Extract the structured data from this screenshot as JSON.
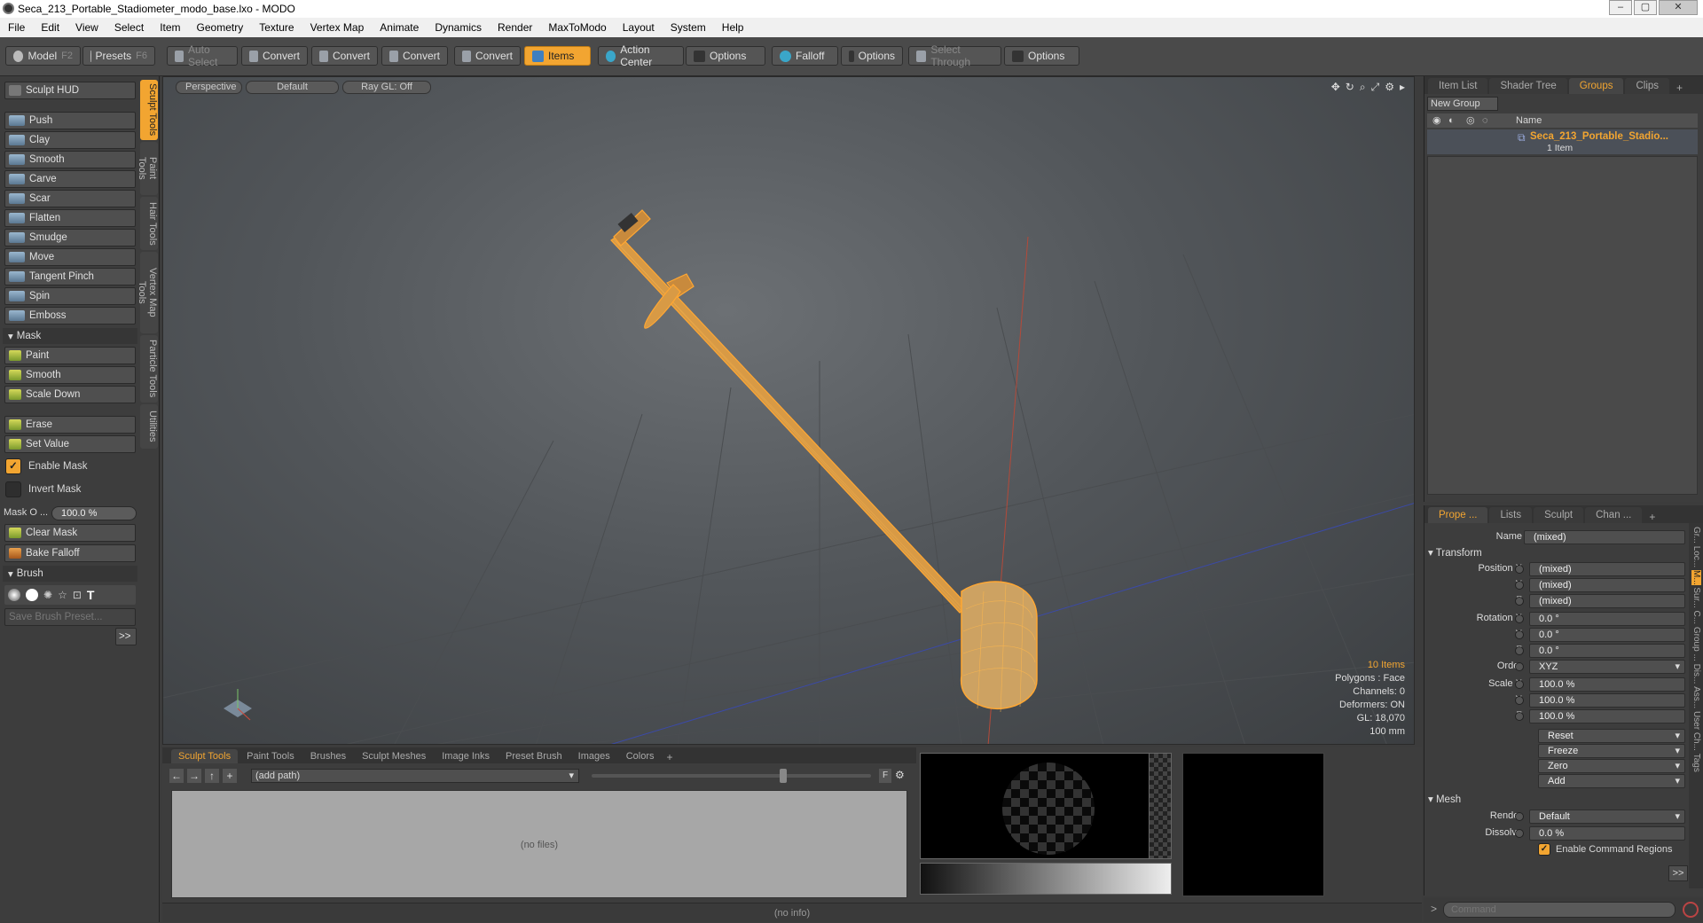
{
  "window": {
    "title": "Seca_213_Portable_Stadiometer_modo_base.lxo - MODO"
  },
  "menu": [
    "File",
    "Edit",
    "View",
    "Select",
    "Item",
    "Geometry",
    "Texture",
    "Vertex Map",
    "Animate",
    "Dynamics",
    "Render",
    "MaxToModo",
    "Layout",
    "System",
    "Help"
  ],
  "toolbar": {
    "model": "Model",
    "model_key": "F2",
    "presets": "Presets",
    "presets_key": "F6",
    "auto_select": "Auto Select",
    "convert1": "Convert",
    "convert2": "Convert",
    "convert3": "Convert",
    "convert4": "Convert",
    "items": "Items",
    "action_center": "Action Center",
    "options1": "Options",
    "falloff": "Falloff",
    "options2": "Options",
    "select_through": "Select Through",
    "options3": "Options"
  },
  "left": {
    "sculpt_hud": "Sculpt HUD",
    "side_tabs": [
      "Sculpt Tools",
      "Paint Tools",
      "Hair Tools",
      "Vertex Map Tools",
      "Particle Tools",
      "Utilities"
    ],
    "tools": [
      "Push",
      "Clay",
      "Smooth",
      "Carve",
      "Scar",
      "Flatten",
      "Smudge",
      "Move",
      "Tangent Pinch",
      "Spin",
      "Emboss"
    ],
    "mask_header": "Mask",
    "mask_tools": [
      "Paint",
      "Smooth",
      "Scale Down"
    ],
    "erase": "Erase",
    "set_value": "Set Value",
    "enable_mask": "Enable Mask",
    "invert_mask": "Invert Mask",
    "mask_opacity_label": "Mask O ...",
    "mask_opacity_value": "100.0 %",
    "clear_mask": "Clear Mask",
    "bake_falloff": "Bake Falloff",
    "brush_header": "Brush",
    "save_brush_preset": "Save Brush Preset...",
    "more": ">>"
  },
  "viewport": {
    "tabs": [
      "Perspective",
      "Default",
      "Ray GL: Off"
    ],
    "stats": {
      "items": "10 Items",
      "polygons": "Polygons : Face",
      "channels": "Channels: 0",
      "deformers": "Deformers: ON",
      "gl": "GL: 18,070",
      "scale": "100 mm"
    }
  },
  "scene_panel": {
    "tabs": [
      "Item List",
      "Shader Tree",
      "Groups",
      "Clips"
    ],
    "new_group": "New Group",
    "col_name": "Name",
    "group_name": "Seca_213_Portable_Stadio...",
    "group_count": "1 Item"
  },
  "props": {
    "tabs": [
      "Prope ...",
      "Lists",
      "Sculpt",
      "Chan ..."
    ],
    "side_tabs": [
      "Gr...",
      "Loc...",
      "M...",
      "Sur...",
      "C...",
      "Group",
      "...",
      "Dis...",
      "Ass...",
      "User Ch...",
      "Tags"
    ],
    "name_label": "Name",
    "name_value": "(mixed)",
    "transform": "Transform",
    "position_x_label": "Position X",
    "position_x": "(mixed)",
    "position_y_label": "Y",
    "position_y": "(mixed)",
    "position_z_label": "Z",
    "position_z": "(mixed)",
    "rotation_x_label": "Rotation X",
    "rotation_x": "0.0 °",
    "rotation_y_label": "Y",
    "rotation_y": "0.0 °",
    "rotation_z_label": "Z",
    "rotation_z": "0.0 °",
    "order_label": "Order",
    "order": "XYZ",
    "scale_x_label": "Scale X",
    "scale_x": "100.0 %",
    "scale_y_label": "Y",
    "scale_y": "100.0 %",
    "scale_z_label": "Z",
    "scale_z": "100.0 %",
    "reset": "Reset",
    "freeze": "Freeze",
    "zero": "Zero",
    "add": "Add",
    "mesh": "Mesh",
    "render_label": "Render",
    "render": "Default",
    "dissolve_label": "Dissolve",
    "dissolve": "0.0 %",
    "enable_command_regions": "Enable Command Regions",
    "more": ">>"
  },
  "bottom": {
    "tabs": [
      "Sculpt Tools",
      "Paint Tools",
      "Brushes",
      "Sculpt Meshes",
      "Image Inks",
      "Preset Brush",
      "Images",
      "Colors"
    ],
    "path": "(add path)",
    "f": "F",
    "no_files": "(no files)"
  },
  "status": {
    "info": "(no info)",
    "command_placeholder": "Command"
  },
  "colors": {
    "accent": "#f2a531",
    "viewport": "#55595d"
  }
}
